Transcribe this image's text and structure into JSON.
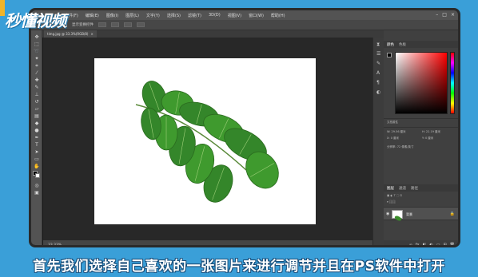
{
  "watermark": {
    "text": "秒懂视频"
  },
  "app": {
    "menu": [
      "文件(F)",
      "编辑(E)",
      "图像(I)",
      "图层(L)",
      "文字(Y)",
      "选择(S)",
      "滤镜(T)",
      "3D(D)",
      "视图(V)",
      "窗口(W)",
      "帮助(H)"
    ],
    "window_controls": {
      "minimize": "–",
      "maximize": "□",
      "close": "×"
    },
    "options_bar": {
      "label": "显示变换控件"
    },
    "document_tab": {
      "title": "timg.jpg @ 33.3%(RGB/8)",
      "close": "×"
    },
    "status_text": "33.33%",
    "panels": {
      "color_tabs": [
        "颜色",
        "色板"
      ],
      "properties_title": "文档属性",
      "properties_rows": [
        "W: 29.56 厘米",
        "H: 22.19 厘米",
        "X: 0 厘米",
        "Y: 0 厘米",
        "分辨率: 72 像素/英寸"
      ],
      "layers_tabs": [
        "图层",
        "通道",
        "路径"
      ],
      "layer_name": "背景",
      "layer_lock_icon": "lock-icon"
    },
    "colors": {
      "accent": "#3a9fd8",
      "leaf": "#3a8c2a"
    }
  },
  "caption": {
    "text": "首先我们选择自己喜欢的一张图片来进行调节并且在PS软件中打开"
  }
}
